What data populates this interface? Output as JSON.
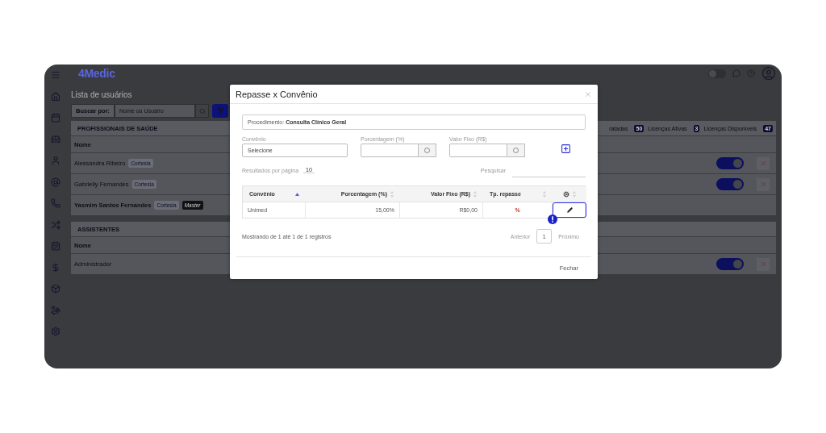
{
  "app": {
    "logo": "4Medic",
    "theme_toggle_on": false,
    "page_title": "Lista de usuários",
    "search": {
      "label": "Buscar por:",
      "placeholder": "Nome ou Usuário"
    },
    "sections": [
      {
        "title": "PROFISSIONAIS DE SAÚDE",
        "badges": [
          {
            "label": "ratadas",
            "count": "50"
          },
          {
            "label": "Licenças Ativas",
            "count": "3"
          },
          {
            "label": "Licenças Disponíveis",
            "count": "47"
          }
        ],
        "column": "Nome",
        "rows": [
          {
            "name": "Alessandra Ribeiro",
            "bold": false,
            "tags": [
              {
                "label": "Cortesia",
                "kind": "outline"
              }
            ],
            "toggle_on": true
          },
          {
            "name": "Gabrielly Fernandes",
            "bold": false,
            "tags": [
              {
                "label": "Cortesia",
                "kind": "outline"
              }
            ],
            "toggle_on": true
          },
          {
            "name": "Yasmim Santos Fernandes",
            "bold": true,
            "tags": [
              {
                "label": "Cortesia",
                "kind": "outline"
              },
              {
                "label": "Master",
                "kind": "solid"
              }
            ]
          }
        ]
      },
      {
        "title": "ASSISTENTES",
        "column": "Nome",
        "rows": [
          {
            "name": "Administrador",
            "bold": false,
            "tags": [],
            "toggle_on": true
          }
        ]
      }
    ]
  },
  "modal": {
    "title": "Repasse x Convênio",
    "procedure": {
      "label": "Procedimento:",
      "value": "Consulta Clínico Geral"
    },
    "fields": [
      {
        "label": "Convênio",
        "kind": "select",
        "value": "Selecione"
      },
      {
        "label": "Porcentagem (%)",
        "kind": "addon"
      },
      {
        "label": "Valor Fixo (R$)",
        "kind": "addon"
      }
    ],
    "page_size": {
      "label": "Resultados por página",
      "value": "10"
    },
    "search_label": "Pesquisar",
    "table": {
      "columns": [
        {
          "label": "Convênio",
          "sorted": true
        },
        {
          "label": "Porcentagem (%)",
          "sorted": false
        },
        {
          "label": "Valor Fixo (R$)",
          "sorted": false
        },
        {
          "label": "Tp. repasse",
          "sorted": false
        }
      ],
      "rows": [
        {
          "convenio": "Unimed",
          "percent": "15,00%",
          "fixed": "R$0,00",
          "type": "%",
          "highlighted": true
        }
      ]
    },
    "info": "Mostrando de 1 até 1 de 1 registros",
    "pagination": {
      "previous": "Anterior",
      "pages": [
        {
          "label": "1",
          "selected": true
        }
      ],
      "next": "Próximo"
    },
    "close_button": "Fechar"
  }
}
